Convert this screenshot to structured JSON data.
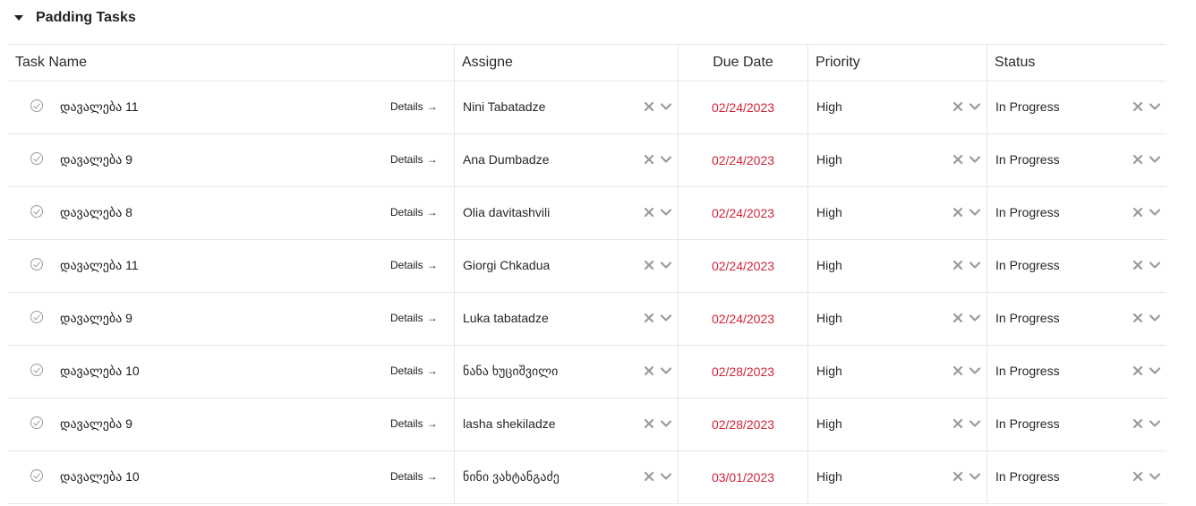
{
  "group": {
    "title": "Padding Tasks"
  },
  "columns": {
    "task": "Task Name",
    "assignee": "Assigne",
    "due": "Due Date",
    "priority": "Priority",
    "status": "Status"
  },
  "details_label": "Details",
  "details_arrow": "→",
  "rows": [
    {
      "name": "დავალება 11",
      "assignee": "Nini Tabatadze",
      "due": "02/24/2023",
      "priority": "High",
      "status": "In Progress"
    },
    {
      "name": "დავალება 9",
      "assignee": "Ana Dumbadze",
      "due": "02/24/2023",
      "priority": "High",
      "status": "In Progress"
    },
    {
      "name": "დავალება 8",
      "assignee": "Olia davitashvili",
      "due": "02/24/2023",
      "priority": "High",
      "status": "In Progress"
    },
    {
      "name": "დავალება 11",
      "assignee": "Giorgi Chkadua",
      "due": "02/24/2023",
      "priority": "High",
      "status": "In Progress"
    },
    {
      "name": "დავალება 9",
      "assignee": "Luka tabatadze",
      "due": "02/24/2023",
      "priority": "High",
      "status": "In Progress"
    },
    {
      "name": "დავალება 10",
      "assignee": "ნანა ხუციშვილი",
      "due": "02/28/2023",
      "priority": "High",
      "status": "In Progress"
    },
    {
      "name": "დავალება 9",
      "assignee": "lasha shekiladze",
      "due": "02/28/2023",
      "priority": "High",
      "status": "In Progress"
    },
    {
      "name": "დავალება 10",
      "assignee": "ნინი ვახტანგაძე",
      "due": "03/01/2023",
      "priority": "High",
      "status": "In Progress"
    }
  ],
  "colors": {
    "due_date": "#d0243a",
    "border": "#e6e6e6",
    "icon": "#9a9a9a"
  },
  "icons": {
    "complete": "check-circle-icon",
    "clear": "clear-x-icon",
    "dropdown": "chevron-down-icon",
    "collapse": "caret-down-icon"
  }
}
